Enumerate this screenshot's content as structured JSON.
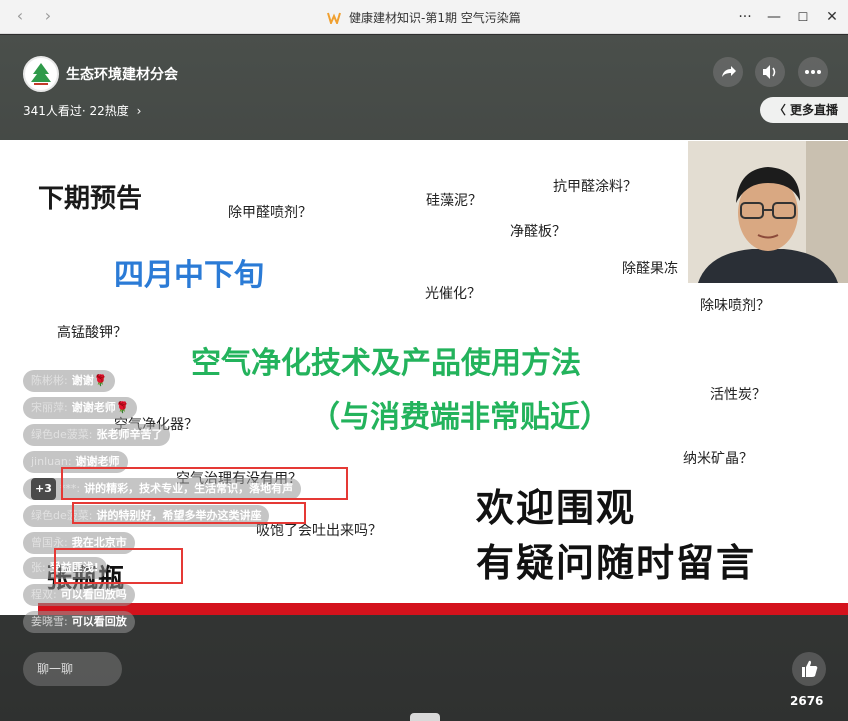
{
  "window": {
    "title": "健康建材知识-第1期 空气污染篇",
    "back_arrow": "‹",
    "forward_arrow": "›",
    "more_icon": "···",
    "minimize_icon": "—",
    "maximize_icon": "☐",
    "close_icon": "✕"
  },
  "channel": {
    "name": "生态环境建材分会",
    "stats": "341人看过· 22热度",
    "stats_chevron": "›",
    "more_live": "〈 更多直播"
  },
  "slide": {
    "heading": "下期预告",
    "date": "四月中下旬",
    "topic_line1": "空气净化技术及产品使用方法",
    "topic_line2": "（与消费端非常贴近）",
    "welcome_line1": "欢迎围观",
    "welcome_line2": "有疑问随时留言",
    "questions": [
      "除甲醛喷剂？",
      "硅藻泥？",
      "抗甲醛涂料？",
      "净醛板？",
      "除醛果冻",
      "光催化？",
      "除味喷剂？",
      "高锰酸钾？",
      "活性炭？",
      "空气净化器？",
      "纳米矿晶？",
      "空气治理有没有用？",
      "吸饱了会吐出来吗？"
    ],
    "overlay_name": "张瓶瓶"
  },
  "comments": [
    {
      "user": "陈彬彬:",
      "msg": "谢谢🌹"
    },
    {
      "user": "宋丽萍:",
      "msg": "谢谢老师🌹"
    },
    {
      "user": "绿色de菠菜:",
      "msg": "张老师辛苦了"
    },
    {
      "user": "jinluan:",
      "msg": "谢谢老师"
    },
    {
      "badge": "+3",
      "user": "***:",
      "msg": "讲的精彩，技术专业，生活常识，落地有声"
    },
    {
      "user": "绿色de菠菜:",
      "msg": "讲的特别好，希望多举办这类讲座"
    },
    {
      "user": "曾国永:",
      "msg": "我在北京市"
    },
    {
      "user": "张:",
      "msg": "受益匪浅!"
    },
    {
      "user": "程双:",
      "msg": "可以看回放吗"
    },
    {
      "user": "姜晓雪:",
      "msg": "可以看回放"
    }
  ],
  "footer": {
    "chat_placeholder": "聊一聊",
    "like_count": "2676"
  },
  "colors": {
    "accent_red": "#d4121c",
    "title_blue": "#2b7bd6",
    "title_green": "#23b35c"
  }
}
